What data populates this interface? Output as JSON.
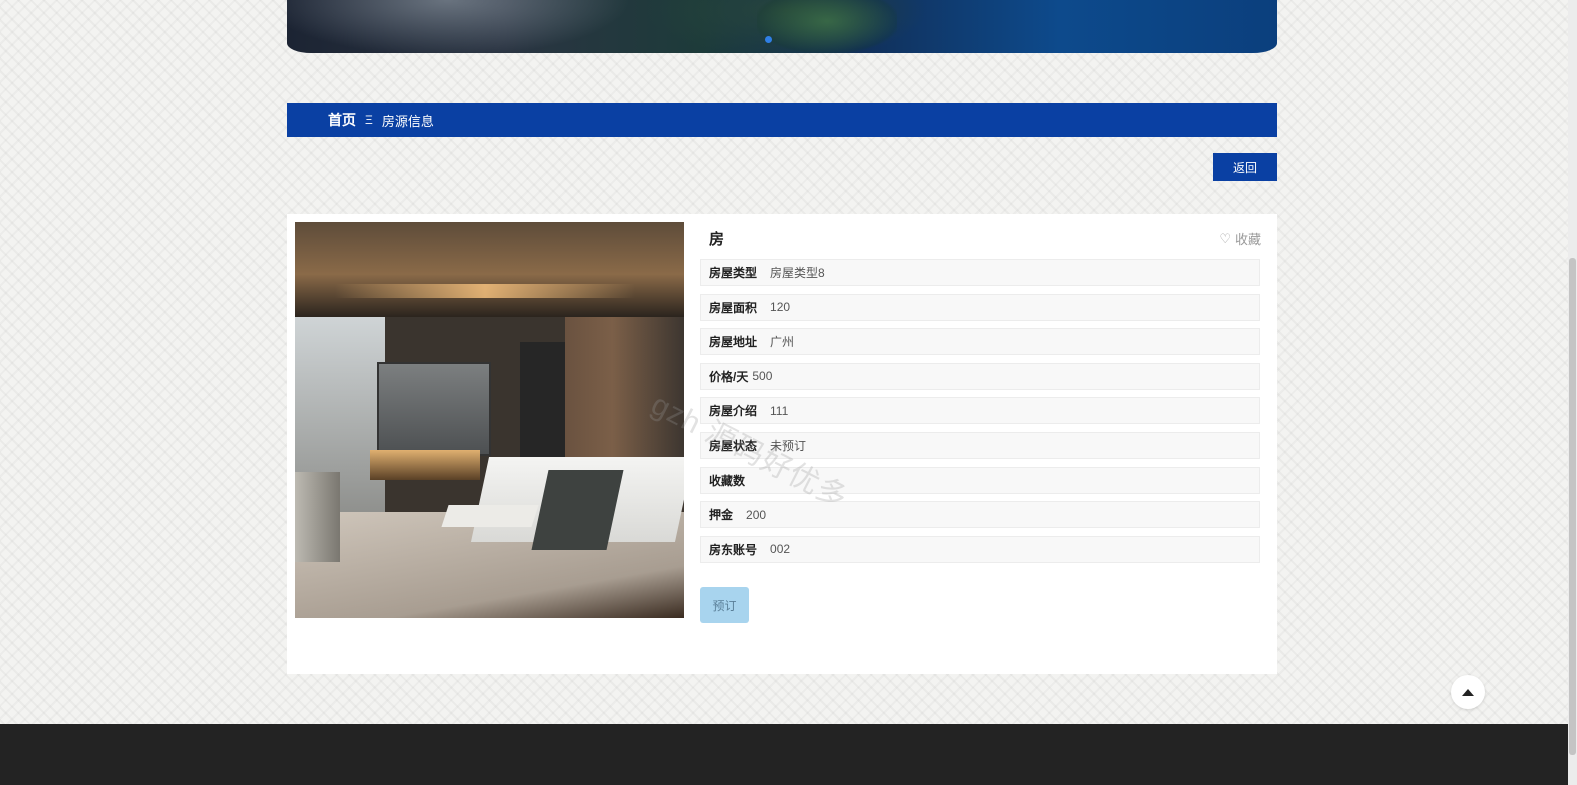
{
  "breadcrumb": {
    "home": "首页",
    "separator": "Ξ",
    "current": "房源信息"
  },
  "actions": {
    "back_label": "返回",
    "favorite_label": "收藏",
    "favorite_icon": "heart-outline-icon",
    "book_label": "预订"
  },
  "listing": {
    "title": "房",
    "attributes": [
      {
        "label": "房屋类型",
        "value": "房屋类型8"
      },
      {
        "label": "房屋面积",
        "value": "120"
      },
      {
        "label": "房屋地址",
        "value": "广州"
      },
      {
        "label": "价格/天",
        "value": "500"
      },
      {
        "label": "房屋介绍",
        "value": "111"
      },
      {
        "label": "房屋状态",
        "value": "未预订"
      },
      {
        "label": "收藏数",
        "value": ""
      },
      {
        "label": "押金",
        "value": "200"
      },
      {
        "label": "房东账号",
        "value": "002"
      }
    ]
  },
  "watermark": "gzh 源码好优多",
  "colors": {
    "primary": "#0a40a3",
    "book_button": "#a8d4ee",
    "footer": "#232323",
    "carousel_dot": "#2f7fe6"
  }
}
